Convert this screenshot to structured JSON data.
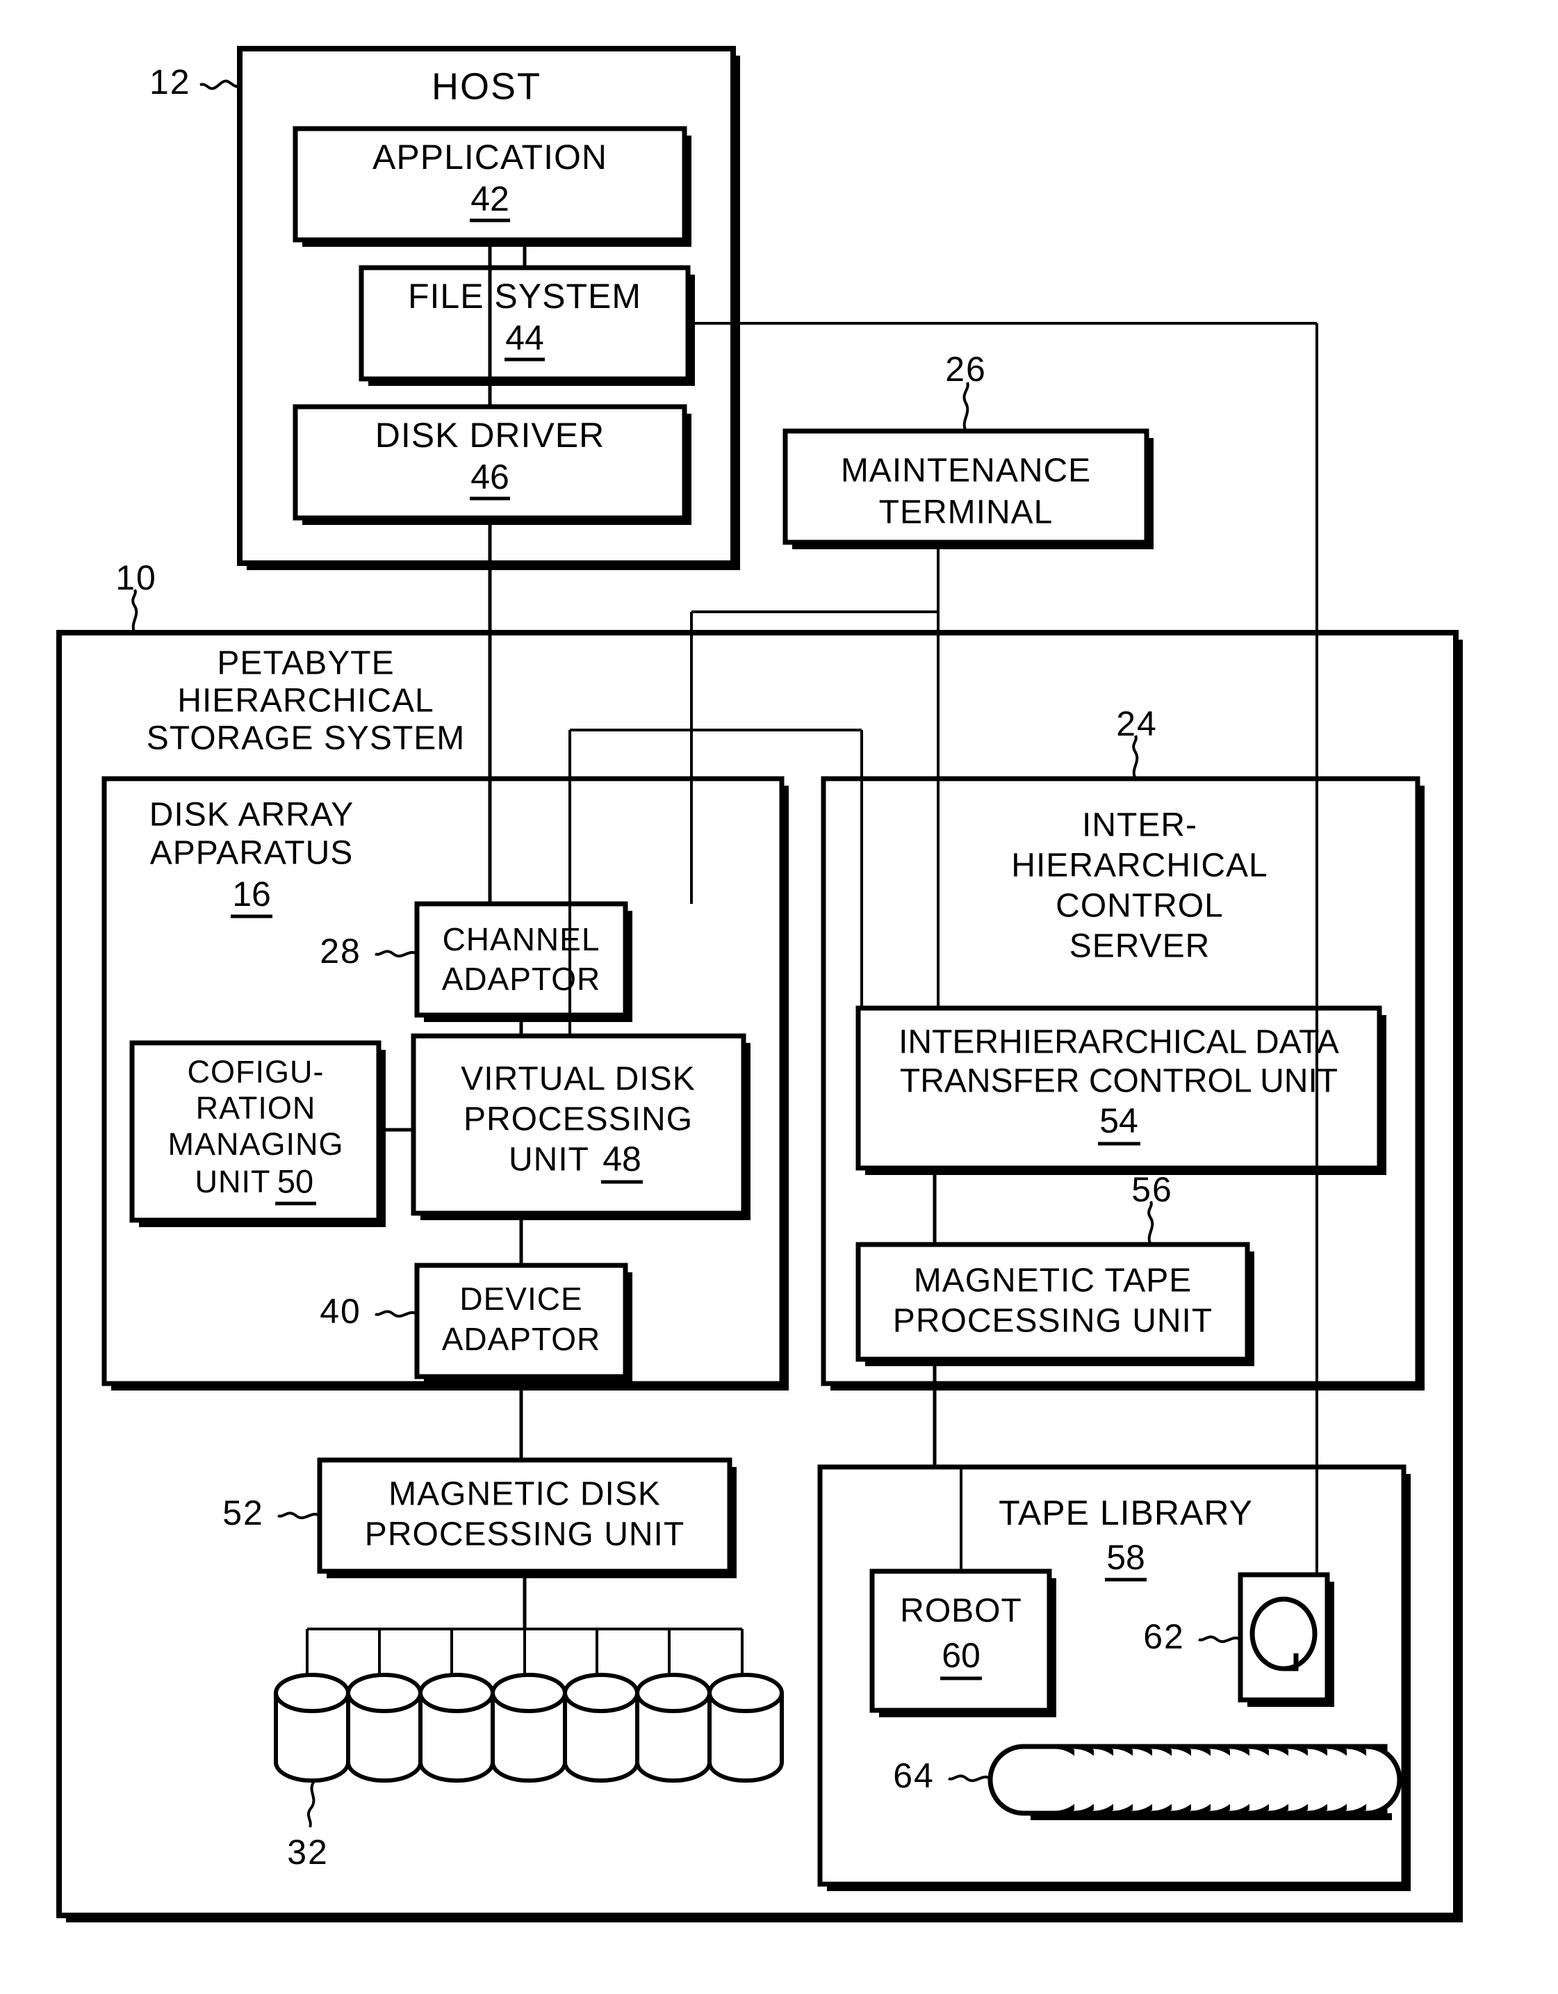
{
  "figure": {
    "type": "patent-block-diagram",
    "title": "Petabyte Hierarchical Storage System block diagram"
  },
  "blocks": {
    "host": {
      "label": "HOST",
      "ref": "12"
    },
    "application": {
      "label": "APPLICATION",
      "ref": "42"
    },
    "file_system": {
      "label": "FILE SYSTEM",
      "ref": "44"
    },
    "disk_driver": {
      "label": "DISK DRIVER",
      "ref": "46"
    },
    "maintenance_terminal": {
      "line1": "MAINTENANCE",
      "line2": "TERMINAL",
      "ref": "26"
    },
    "storage_system": {
      "line1": "PETABYTE",
      "line2": "HIERARCHICAL",
      "line3": "STORAGE SYSTEM",
      "ref": "10"
    },
    "disk_array_apparatus": {
      "line1": "DISK ARRAY",
      "line2": "APPARATUS",
      "ref": "16"
    },
    "channel_adaptor": {
      "line1": "CHANNEL",
      "line2": "ADAPTOR",
      "ref": "28"
    },
    "configuration_managing_unit": {
      "line1": "COFIGU-",
      "line2": "RATION",
      "line3": "MANAGING",
      "line4": "UNIT",
      "ref": "50"
    },
    "virtual_disk_processing_unit": {
      "line1": "VIRTUAL DISK",
      "line2": "PROCESSING",
      "line3": "UNIT",
      "ref": "48"
    },
    "device_adaptor": {
      "line1": "DEVICE",
      "line2": "ADAPTOR",
      "ref": "40"
    },
    "inter_hierarchical_control_server": {
      "line1": "INTER-",
      "line2": "HIERARCHICAL",
      "line3": "CONTROL",
      "line4": "SERVER",
      "ref": "24"
    },
    "interhierarchical_data_transfer_control_unit": {
      "line1": "INTERHIERARCHICAL DATA",
      "line2": "TRANSFER CONTROL UNIT",
      "ref": "54"
    },
    "magnetic_tape_processing_unit": {
      "line1": "MAGNETIC TAPE",
      "line2": "PROCESSING UNIT",
      "ref": "56"
    },
    "magnetic_disk_processing_unit": {
      "line1": "MAGNETIC DISK",
      "line2": "PROCESSING UNIT",
      "ref": "52"
    },
    "magnetic_disks": {
      "ref": "32",
      "count": 7
    },
    "tape_library": {
      "label": "TAPE LIBRARY",
      "ref": "58"
    },
    "robot": {
      "label": "ROBOT",
      "ref": "60"
    },
    "tape_drive": {
      "ref": "62"
    },
    "tape_cartridges": {
      "ref": "64",
      "count": 18
    }
  },
  "colors": {
    "ink": "#000000",
    "paper": "#ffffff"
  }
}
